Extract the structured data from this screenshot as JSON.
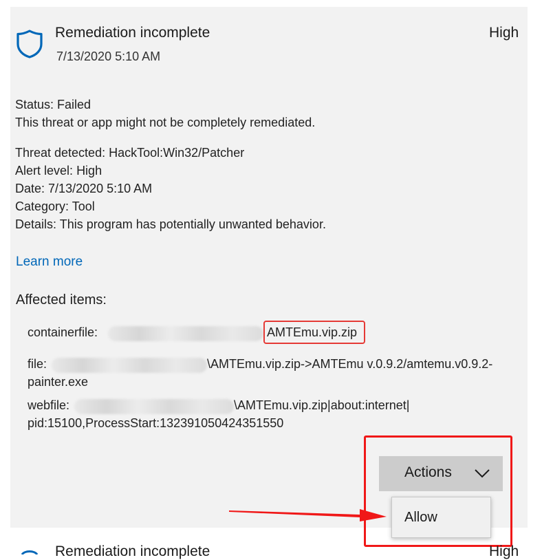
{
  "alert": {
    "title": "Remediation incomplete",
    "date": "7/13/2020 5:10 AM",
    "severity": "High"
  },
  "status": {
    "label": "Status:",
    "value": "Failed",
    "message": "This threat or app might not be completely remediated."
  },
  "details": {
    "threat_label": "Threat detected:",
    "threat_value": "HackTool:Win32/Patcher",
    "alert_level_label": "Alert level:",
    "alert_level_value": "High",
    "date_label": "Date:",
    "date_value": "7/13/2020 5:10 AM",
    "category_label": "Category:",
    "category_value": "Tool",
    "details_label": "Details:",
    "details_value": "This program has potentially unwanted behavior."
  },
  "learn_more": "Learn more",
  "affected": {
    "title": "Affected items:",
    "containerfile_label": "containerfile:",
    "containerfile_value": "AMTEmu.vip.zip",
    "file_label": "file:",
    "file_value_line1": "\\AMTEmu.vip.zip->AMTEmu v.0.9.2/amtemu.v0.9.2-",
    "file_value_line2": "painter.exe",
    "webfile_label": "webfile:",
    "webfile_value_line1": "\\AMTEmu.vip.zip|about:internet|",
    "webfile_value_line2": "pid:15100,ProcessStart:132391050424351550"
  },
  "actions": {
    "button_label": "Actions",
    "menu": [
      "Allow"
    ]
  },
  "next_alert": {
    "title": "Remediation incomplete",
    "severity": "High"
  },
  "colors": {
    "accent": "#0067b8",
    "annotation": "#e53935",
    "panel": "#f2f2f2",
    "button": "#cccccc"
  }
}
